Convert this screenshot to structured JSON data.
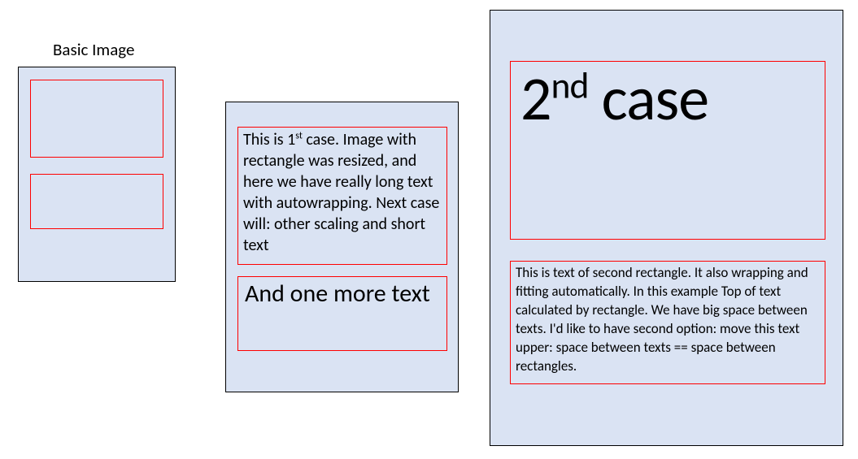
{
  "basic_image": {
    "label": "Basic Image"
  },
  "case1": {
    "text1_pre": "This is 1",
    "text1_sup": "st",
    "text1_post": " case. Image with rectangle was resized, and here we have really long text with autowrapping. Next case will: other scaling and short text",
    "text2": "And one more text"
  },
  "case2": {
    "text1_pre": "2",
    "text1_sup": "nd",
    "text1_post": " case",
    "text2": "This is text of second rectangle. It also wrapping and fitting automatically. In this example Top of text calculated by rectangle. We have big space between texts. I'd like to have second option: move this text upper: space between texts == space between rectangles."
  }
}
